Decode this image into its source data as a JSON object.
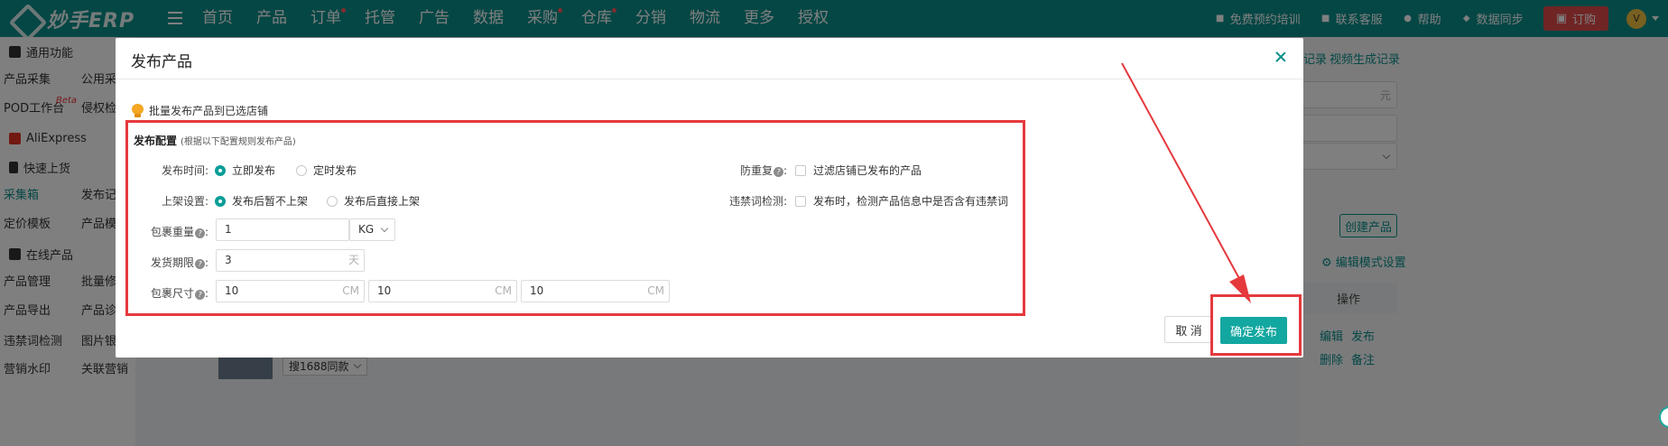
{
  "app": {
    "logo_text": "妙手ERP"
  },
  "nav": {
    "items": [
      {
        "label": "首页",
        "dot": false
      },
      {
        "label": "产品",
        "dot": false
      },
      {
        "label": "订单",
        "dot": true
      },
      {
        "label": "托管",
        "dot": false
      },
      {
        "label": "广告",
        "dot": false
      },
      {
        "label": "数据",
        "dot": false
      },
      {
        "label": "采购",
        "dot": true
      },
      {
        "label": "仓库",
        "dot": true
      },
      {
        "label": "分销",
        "dot": false
      },
      {
        "label": "物流",
        "dot": false
      },
      {
        "label": "更多",
        "dot": false
      },
      {
        "label": "授权",
        "dot": false
      }
    ]
  },
  "topright": {
    "training": "免费预约培训",
    "service": "联系客服",
    "help": "帮助",
    "sync": "数据同步",
    "order": "订购",
    "avatar": "V"
  },
  "sidebar": {
    "common": "通用功能",
    "collect": "产品采集",
    "public_collect": "公用采集",
    "pod": "POD工作台",
    "beta": "Beta",
    "infringe": "侵权检测",
    "aliexpress": "AliExpress",
    "quick_upload": "快速上货",
    "collect_box": "采集箱",
    "publish_record": "发布记录",
    "pricing": "定价模板",
    "product_tpl": "产品模板",
    "online": "在线产品",
    "product_mgmt": "产品管理",
    "batch_edit": "批量修改",
    "export": "产品导出",
    "diagnose": "产品诊断",
    "banned_words": "违禁词检测",
    "image_bank": "图片银行",
    "watermark": "营销水印",
    "related": "关联营销"
  },
  "background": {
    "link_records": "记录",
    "link_video": "视频生成记录",
    "currency_unit": "元",
    "create_product": "创建产品",
    "edit_mode": "编辑模式设置",
    "col_action": "操作",
    "row_edit": "编辑",
    "row_publish": "发布",
    "row_delete": "删除",
    "row_note": "备注",
    "search_1688": "搜1688同款"
  },
  "modal": {
    "title": "发布产品",
    "tip": "批量发布产品到已选店铺",
    "config_title": "发布配置",
    "config_hint": "(根据以下配置规则发布产品)",
    "publish_time": {
      "label": "发布时间:",
      "options": [
        "立即发布",
        "定时发布"
      ],
      "selected": "立即发布"
    },
    "listing": {
      "label": "上架设置:",
      "options": [
        "发布后暂不上架",
        "发布后直接上架"
      ],
      "selected": "发布后暂不上架"
    },
    "weight": {
      "label": "包裹重量",
      "value": "1",
      "unit": "KG"
    },
    "ship_days": {
      "label": "发货期限",
      "value": "3",
      "unit": "天"
    },
    "size": {
      "label": "包裹尺寸",
      "length": "10",
      "width": "10",
      "height": "10",
      "unit": "CM"
    },
    "dedup": {
      "label": "防重复",
      "checkbox": "过滤店铺已发布的产品",
      "checked": false
    },
    "banned": {
      "label": "违禁词检测:",
      "checkbox": "发布时，检测产品信息中是否含有违禁词",
      "checked": false
    },
    "cancel": "取 消",
    "confirm": "确定发布"
  }
}
